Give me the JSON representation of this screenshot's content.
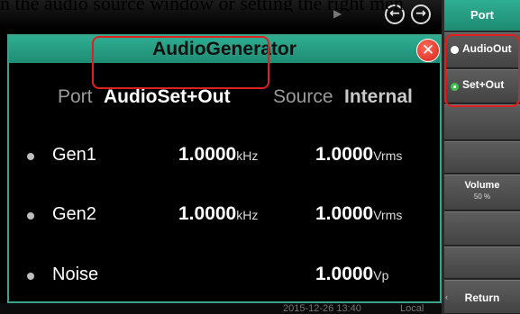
{
  "caption": "n the audio source window or setting the right men",
  "window": {
    "title": "AudioGenerator"
  },
  "topbar": {
    "mute_icon": "mute-icon",
    "back_icon": "left-arrow-icon",
    "forward_icon": "right-arrow-icon"
  },
  "port": {
    "label": "Port",
    "value": "AudioSet+Out"
  },
  "source": {
    "label": "Source",
    "value": "Internal"
  },
  "rows": [
    {
      "name": "Gen1",
      "freq": "1.0000",
      "freq_unit": "kHz",
      "amp": "1.0000",
      "amp_unit": "Vrms"
    },
    {
      "name": "Gen2",
      "freq": "1.0000",
      "freq_unit": "kHz",
      "amp": "1.0000",
      "amp_unit": "Vrms"
    },
    {
      "name": "Noise",
      "freq": "",
      "freq_unit": "",
      "amp": "1.0000",
      "amp_unit": "Vp"
    }
  ],
  "status": {
    "timestamp": "2015-12-26 13:40",
    "mode": "Local"
  },
  "softkeys": {
    "header": "Port",
    "audio_out": "AudioOut",
    "set_out": "Set+Out",
    "volume_label": "Volume",
    "volume_value": "50 %",
    "return_label": "Return"
  },
  "colors": {
    "accent": "#2fae92",
    "highlight": "#e02020",
    "selected": "#40c050"
  }
}
